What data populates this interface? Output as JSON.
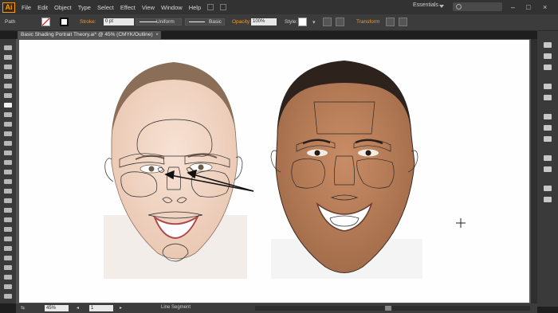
{
  "app": {
    "logo": "Ai"
  },
  "menu": [
    "File",
    "Edit",
    "Object",
    "Type",
    "Select",
    "Effect",
    "View",
    "Window",
    "Help"
  ],
  "workspace": {
    "label": "Essentials"
  },
  "control": {
    "selection_label": "Path",
    "stroke_label": "Stroke:",
    "stroke_value": "0 pt",
    "profile_label": "Uniform",
    "brush_label": "Basic",
    "opacity_label": "Opacity:",
    "opacity_value": "100%",
    "style_label": "Style:",
    "transform_label": "Transform"
  },
  "document": {
    "tab_title": "Basic Shading Portrait Theory.ai* @ 45% (CMYK/Outline)",
    "close": "×"
  },
  "status": {
    "zoom": "45%",
    "artboard": "1",
    "tool": "Line Segment"
  },
  "window_controls": {
    "minimize": "–",
    "maximize": "□",
    "close": "×"
  },
  "colors": {
    "accent": "#f39a1e",
    "ui_dark": "#323232",
    "artboard": "#ffffff",
    "outline": "#2a2a2a"
  },
  "icons": [
    "selection-tool",
    "direct-selection-tool",
    "magic-wand-tool",
    "lasso-tool",
    "pen-tool",
    "type-tool",
    "line-segment-tool",
    "rectangle-tool",
    "paintbrush-tool",
    "pencil-tool",
    "eraser-tool",
    "rotate-tool",
    "scale-tool",
    "width-tool",
    "free-transform-tool",
    "shape-builder-tool",
    "perspective-grid-tool",
    "mesh-tool",
    "gradient-tool",
    "eyedropper-tool",
    "blend-tool",
    "symbol-sprayer-tool",
    "column-graph-tool",
    "artboard-tool",
    "slice-tool",
    "hand-tool",
    "zoom-tool"
  ]
}
